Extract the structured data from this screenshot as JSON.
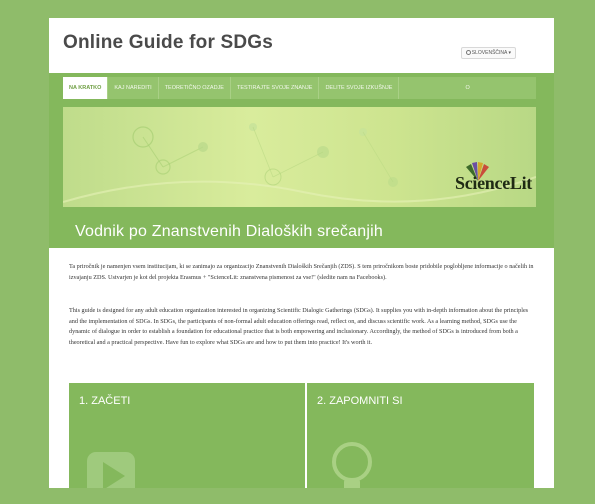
{
  "site": {
    "title": "Online Guide for SDGs"
  },
  "language": {
    "selected": "SLOVENŠČINA",
    "chevron": "▾",
    "icon": "globe-icon"
  },
  "nav": {
    "items": [
      {
        "label": "NA KRATKO",
        "active": true
      },
      {
        "label": "KAJ NAREDITI",
        "active": false
      },
      {
        "label": "TEORETIČNO OZADJE",
        "active": false
      },
      {
        "label": "TESTIRAJTE SVOJE ZNANJE",
        "active": false
      },
      {
        "label": "DELITE SVOJE IZKUŠNJE",
        "active": false
      },
      {
        "label": "O",
        "active": false
      }
    ]
  },
  "banner": {
    "logo_text": "ScienceLit"
  },
  "page": {
    "title": "Vodnik po Znanstvenih Dialoških srečanjih"
  },
  "content": {
    "para1": "Ta priročnik je namenjen vsem institucijam, ki se zanimajo za organizacijo Znanstvenih Dialoških Srečanjih (ZDS). S tem priročnikom boste pridobile poglobljene informacije o  načelih in izvajanju ZDS. Ustvarjen je kot del projekta Erasmus + \"ScienceLit: znanstvena pismenost za vse!\" (sledite nam na Facebooks).",
    "para2": "This guide is designed for any adult education organization interested in organizing Scientific Dialogic Gatherings (SDGs). It supplies you with in-depth information about the principles and the implementation of SDGs. In SDGs, the participants of non-formal adult education offerings read, reflect on, and discuss scientific work. As a learning method, SDGs use the dynamic of dialogue in order to establish a foundation for educational practice that is both empowering and inclusionary. Accordingly, the method of SDGs is introduced from both a theoretical and a practical perspective. Have fun to explore what SDGs are and how to put them into practice! It's worth it."
  },
  "cards": [
    {
      "title": "1. ZAČETI",
      "icon": "play-icon"
    },
    {
      "title": "2. ZAPOMNITI SI",
      "icon": "lightbulb-icon"
    }
  ],
  "colors": {
    "background": "#8fbc6a",
    "accent_green": "#84b85c",
    "nav_active_text": "#6f9f43"
  }
}
